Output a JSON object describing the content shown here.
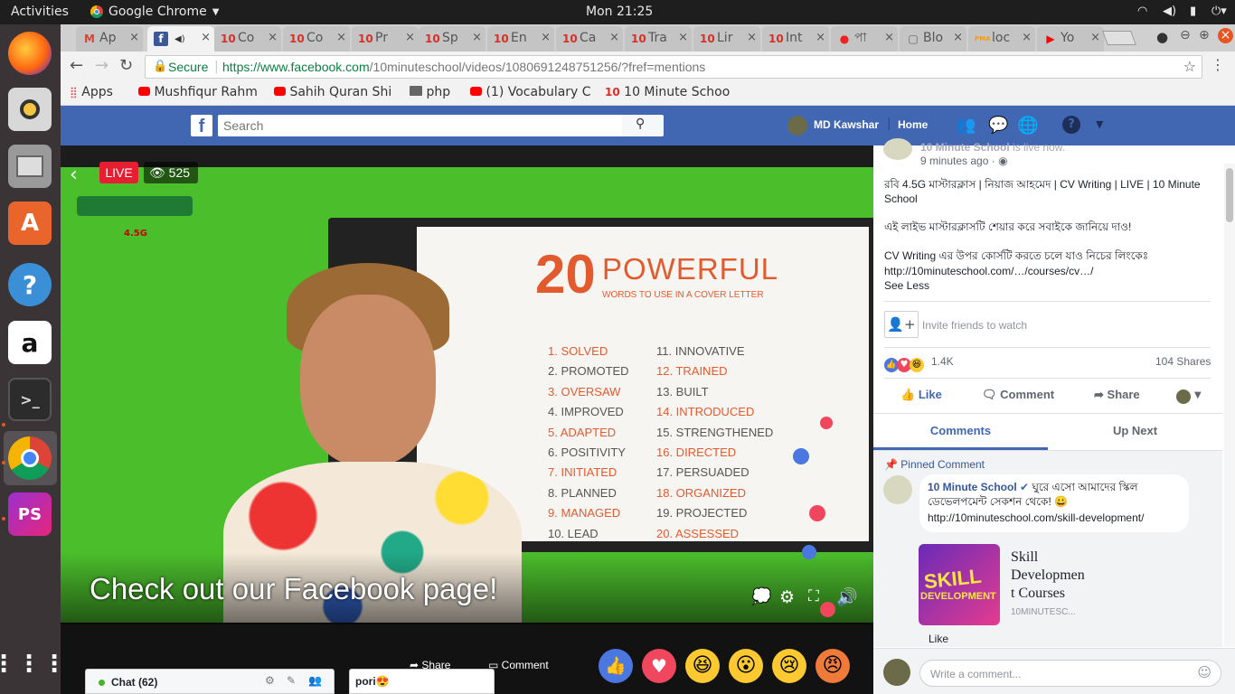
{
  "os": {
    "activities": "Activities",
    "app_name": "Google Chrome",
    "clock": "Mon 21:25"
  },
  "tabs": [
    {
      "fav": "M",
      "label": "Ap",
      "color": "#d44638"
    },
    {
      "fav": "f",
      "label": "",
      "color": "#3b5998"
    },
    {
      "fav": "10",
      "label": "Co",
      "color": "#d93025"
    },
    {
      "fav": "10",
      "label": "Co",
      "color": "#d93025"
    },
    {
      "fav": "10",
      "label": "Pr",
      "color": "#d93025"
    },
    {
      "fav": "10",
      "label": "Sp",
      "color": "#d93025"
    },
    {
      "fav": "10",
      "label": "En",
      "color": "#d93025"
    },
    {
      "fav": "10",
      "label": "Ca",
      "color": "#d93025"
    },
    {
      "fav": "10",
      "label": "Tra",
      "color": "#d93025"
    },
    {
      "fav": "10",
      "label": "Lir",
      "color": "#d93025"
    },
    {
      "fav": "10",
      "label": "Int",
      "color": "#d93025"
    },
    {
      "fav": "●",
      "label": "পা",
      "color": "#e22"
    },
    {
      "fav": "▢",
      "label": "Blo",
      "color": "#666"
    },
    {
      "fav": "PMA",
      "label": "loc",
      "color": "#f89c0e"
    },
    {
      "fav": "▶",
      "label": "Yo",
      "color": "#f00"
    }
  ],
  "address": {
    "secure_label": "Secure",
    "url_host": "https://www.facebook.com",
    "url_path": "/10minuteschool/videos/1080691248751256/?fref=mentions"
  },
  "bookmarks": [
    {
      "label": "Apps",
      "icon": "apps-grid-icon"
    },
    {
      "label": "Mushfiqur Rahm",
      "icon": "youtube-icon"
    },
    {
      "label": "Sahih Quran Shi",
      "icon": "youtube-icon"
    },
    {
      "label": "php",
      "icon": "folder-icon"
    },
    {
      "label": "(1) Vocabulary C",
      "icon": "youtube-icon"
    },
    {
      "label": "10 Minute Schoo",
      "icon": "ten-minute-school-icon"
    }
  ],
  "facebook": {
    "search_placeholder": "Search",
    "user_name": "MD Kawshar",
    "home_label": "Home"
  },
  "video": {
    "live_label": "LIVE",
    "viewers": "525",
    "caption": "Check out our Facebook page!",
    "board": {
      "number": "20",
      "title": "POWERFUL",
      "subtitle": "WORDS TO USE IN A COVER LETTER",
      "words_left": [
        "1. SOLVED",
        "2. PROMOTED",
        "3. OVERSAW",
        "4. IMPROVED",
        "5. ADAPTED",
        "6. POSITIVITY",
        "7. INITIATED",
        "8. PLANNED",
        "9. MANAGED",
        "10. LEAD"
      ],
      "words_right": [
        "11. INNOVATIVE",
        "12. TRAINED",
        "13. BUILT",
        "14. INTRODUCED",
        "15. STRENGTHENED",
        "16. DIRECTED",
        "17. PERSUADED",
        "18. ORGANIZED",
        "19. PROJECTED",
        "20. ASSESSED"
      ]
    },
    "share_label": "Share",
    "comment_label": "Comment",
    "chat_label": "Chat (62)",
    "chat_user": "pori😍"
  },
  "post": {
    "page_name": "10 Minute School",
    "status": "is live now.",
    "time": "9 minutes ago ·",
    "title": "রবি 4.5G মাস্টারক্লাস | নিয়াজ আহমেদ | CV Writing | LIVE | 10 Minute School",
    "line1": "এই লাইভ মাস্টারক্লাসটি শেয়ার করে সবাইকে জানিয়ে দাও!",
    "line2": "CV Writing এর উপর কোর্সটি করতে চলে যাও নিচের লিংকেঃ",
    "link": "http://10minuteschool.com/…/courses/cv…/",
    "see_less": "See Less",
    "invite": "Invite friends to watch",
    "reactions_count": "1.4K",
    "shares": "104 Shares",
    "like": "Like",
    "comment": "Comment",
    "share": "Share",
    "tab_comments": "Comments",
    "tab_upnext": "Up Next",
    "pinned": "Pinned Comment",
    "pinned_author": "10 Minute School",
    "pinned_text": "ঘুরে এসো আমাদের স্কিল ডেভেলপমেন্ট সেকশন থেকে! 😀",
    "pinned_link": "http://10minuteschool.com/skill-development/",
    "preview_title": "Skill Developmen t Courses",
    "preview_domain": "10MINUTESC...",
    "pinned_like": "Like",
    "write_comment": "Write a comment..."
  }
}
